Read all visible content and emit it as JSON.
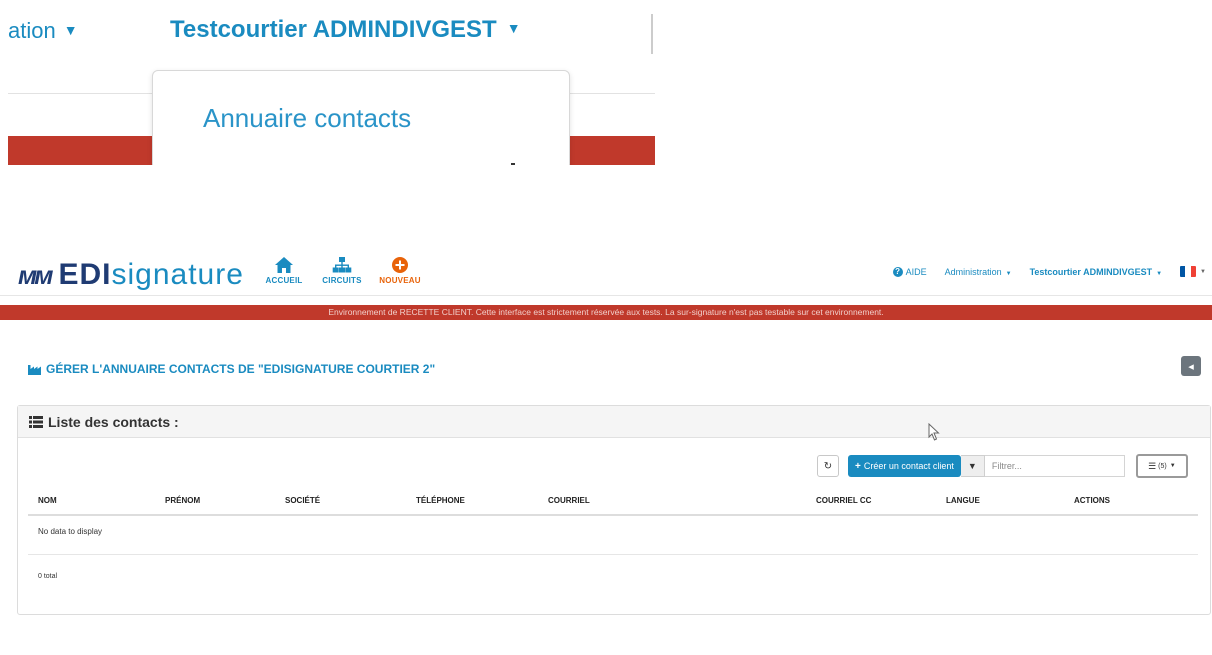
{
  "zoom": {
    "partial_menu": "ation",
    "user_menu": "Testcourtier ADMINDIVGEST",
    "dropdown_item": "Annuaire contacts"
  },
  "brand": {
    "logo_mark": "ᴍᴍ",
    "name_bold": "EDI",
    "name_light": "signature"
  },
  "nav": {
    "home": "ACCUEIL",
    "circuits": "CIRCUITS",
    "new": "NOUVEAU",
    "help": "AIDE",
    "admin": "Administration",
    "user": "Testcourtier ADMINDIVGEST"
  },
  "banner": "Environnement de RECETTE CLIENT. Cette interface est strictement réservée aux tests. La sur-signature n'est pas testable sur cet environnement.",
  "page": {
    "title": "GÉRER L'ANNUAIRE CONTACTS DE \"EDISIGNATURE COURTIER 2\""
  },
  "panel": {
    "title": "Liste des contacts :",
    "create_button": "Créer un contact client",
    "filter_placeholder": "Filtrer...",
    "columns_count": "(5)",
    "headers": [
      "NOM",
      "PRÉNOM",
      "SOCIÉTÉ",
      "TÉLÉPHONE",
      "COURRIEL",
      "COURRIEL CC",
      "LANGUE",
      "ACTIONS"
    ],
    "empty": "No data to display",
    "total": "0 total"
  },
  "colors": {
    "primary": "#1a8bc0",
    "accent": "#e8630a",
    "banner": "#c0392b",
    "brand": "#1f3b73"
  },
  "icons": {
    "home": "home-icon",
    "circuits": "sitemap-icon",
    "new": "plus-circle-icon",
    "help": "question-circle-icon",
    "back": "arrow-left-icon",
    "refresh": "refresh-icon",
    "filter": "filter-icon",
    "columns": "list-icon",
    "title": "industry-icon"
  }
}
